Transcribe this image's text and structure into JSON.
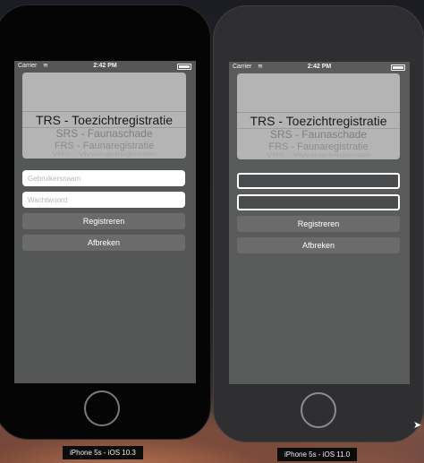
{
  "simulators": [
    {
      "device_label": "iPhone 5s - iOS 10.3",
      "status": {
        "carrier": "Carrier",
        "time": "2:42 PM"
      },
      "picker_options": [
        "TRS - Toezichtregistratie",
        "SRS - Faunaschade",
        "FRS - Faunaregistratie",
        "VRS - Vlyvangstregistratie"
      ],
      "username_placeholder": "Gebruikersnaam",
      "password_placeholder": "Wachtwoord",
      "register_label": "Registreren",
      "cancel_label": "Afbreken"
    },
    {
      "device_label": "iPhone 5s - iOS 11.0",
      "status": {
        "carrier": "Carrier",
        "time": "2:42 PM"
      },
      "picker_options": [
        "TRS - Toezichtregistratie",
        "SRS - Faunaschade",
        "FRS - Faunaregistratie",
        "VRS - Vlyvangstregistratie"
      ],
      "username_placeholder": "",
      "password_placeholder": "",
      "register_label": "Registreren",
      "cancel_label": "Afbreken"
    }
  ],
  "icons": {
    "wifi": "wifi-icon",
    "battery": "battery-icon",
    "home": "home-button-icon",
    "cursor": "mouse-pointer-icon"
  }
}
